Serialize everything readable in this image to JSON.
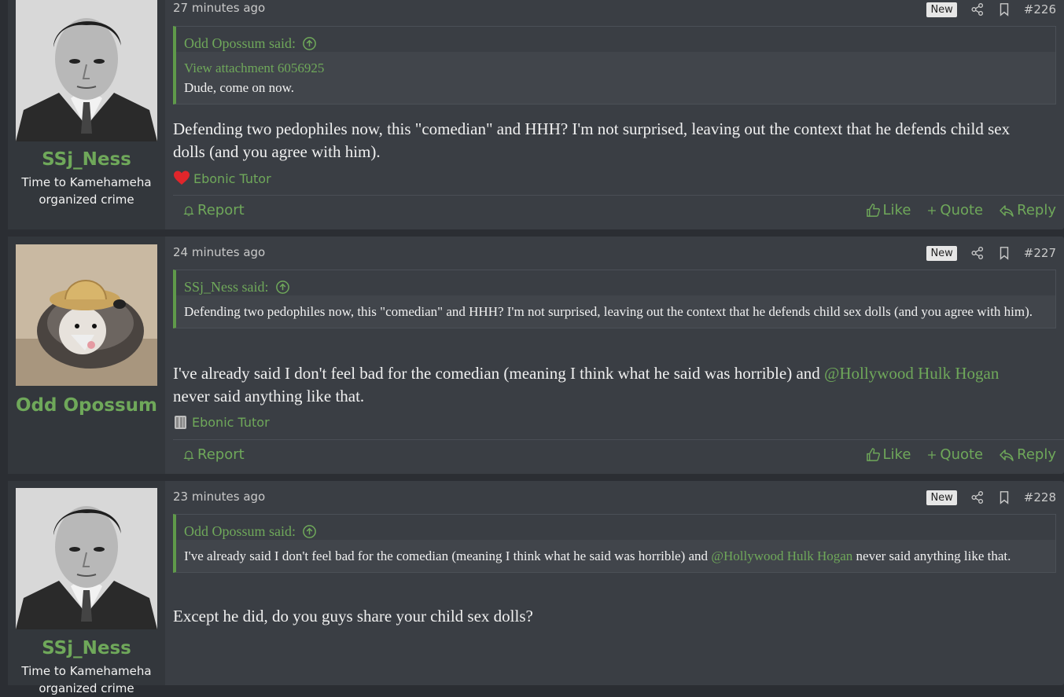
{
  "posts": [
    {
      "username": "SSj_Ness",
      "user_title": "Time to Kamehameha organized crime",
      "time": "27 minutes ago",
      "badge": "New",
      "number": "#226",
      "quote_author": "Odd Opossum said:",
      "quote_attachment": "View attachment 6056925",
      "quote_text": "Dude, come on now.",
      "body": "Defending two pedophiles now, this \"comedian\" and HHH? I'm not surprised, leaving out the context that he defends child sex dolls (and you agree with him).",
      "reaction_user": "Ebonic Tutor",
      "report": "Report",
      "like": "Like",
      "quote": "Quote",
      "reply": "Reply"
    },
    {
      "username": "Odd Opossum",
      "time": "24 minutes ago",
      "badge": "New",
      "number": "#227",
      "quote_author": "SSj_Ness said:",
      "quote_text": "Defending two pedophiles now, this \"comedian\" and HHH? I'm not surprised, leaving out the context that he defends child sex dolls (and you agree with him).",
      "body_before": "I've already said I don't feel bad for the comedian (meaning I think what he said was horrible) and ",
      "mention": "@Hollywood Hulk Hogan",
      "body_after": " never said anything like that.",
      "reaction_user": "Ebonic Tutor",
      "report": "Report",
      "like": "Like",
      "quote": "Quote",
      "reply": "Reply"
    },
    {
      "username": "SSj_Ness",
      "user_title": "Time to Kamehameha organized crime",
      "time": "23 minutes ago",
      "badge": "New",
      "number": "#228",
      "quote_author": "Odd Opossum said:",
      "quote_before": "I've already said I don't feel bad for the comedian (meaning I think what he said was horrible) and ",
      "quote_mention": "@Hollywood Hulk Hogan",
      "quote_after": " never said anything like that.",
      "body": "Except he did, do you guys share your child sex dolls?"
    }
  ],
  "colors": {
    "accent": "#6fa85a",
    "background": "#2b2e33",
    "post_bg": "#3a3e44",
    "sidebar_bg": "#33373c"
  }
}
